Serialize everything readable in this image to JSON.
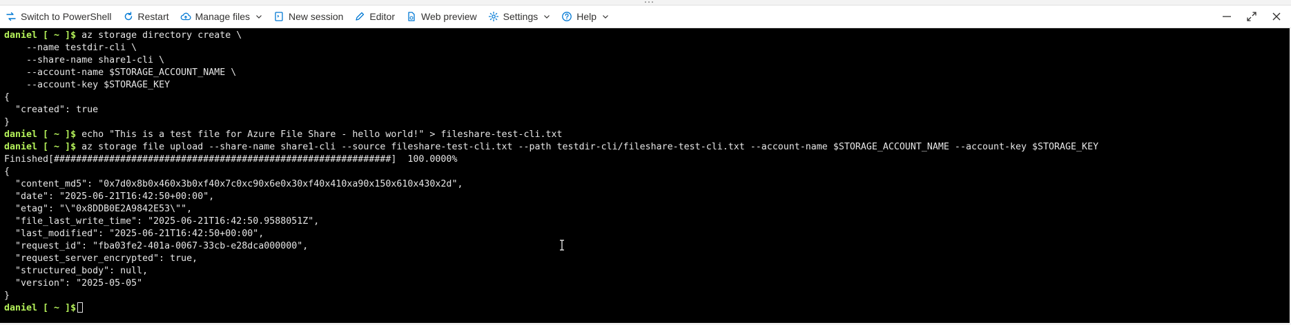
{
  "toolbar": {
    "switch_label": "Switch to PowerShell",
    "restart_label": "Restart",
    "manage_files_label": "Manage files",
    "new_session_label": "New session",
    "editor_label": "Editor",
    "web_preview_label": "Web preview",
    "settings_label": "Settings",
    "help_label": "Help"
  },
  "colors": {
    "terminal_bg": "#000000",
    "prompt_green": "#b5f25a",
    "text": "#e6e6e6",
    "accent_blue": "#0078d4"
  },
  "terminal": {
    "prompt": "daniel [ ~ ]$",
    "lines": [
      {
        "prompt": "daniel [ ~ ]$",
        "text": " az storage directory create \\"
      },
      {
        "prompt": "",
        "text": "    --name testdir-cli \\"
      },
      {
        "prompt": "",
        "text": "    --share-name share1-cli \\"
      },
      {
        "prompt": "",
        "text": "    --account-name $STORAGE_ACCOUNT_NAME \\"
      },
      {
        "prompt": "",
        "text": "    --account-key $STORAGE_KEY"
      },
      {
        "prompt": "",
        "text": "{"
      },
      {
        "prompt": "",
        "text": "  \"created\": true"
      },
      {
        "prompt": "",
        "text": "}"
      },
      {
        "prompt": "daniel [ ~ ]$",
        "text": " echo \"This is a test file for Azure File Share - hello world!\" > fileshare-test-cli.txt"
      },
      {
        "prompt": "daniel [ ~ ]$",
        "text": " az storage file upload --share-name share1-cli --source fileshare-test-cli.txt --path testdir-cli/fileshare-test-cli.txt --account-name $STORAGE_ACCOUNT_NAME --account-key $STORAGE_KEY"
      },
      {
        "prompt": "",
        "text": "Finished[#############################################################]  100.0000%"
      },
      {
        "prompt": "",
        "text": "{"
      },
      {
        "prompt": "",
        "text": "  \"content_md5\": \"0x7d0x8b0x460x3b0xf40x7c0xc90x6e0x30xf40x410xa90x150x610x430x2d\","
      },
      {
        "prompt": "",
        "text": "  \"date\": \"2025-06-21T16:42:50+00:00\","
      },
      {
        "prompt": "",
        "text": "  \"etag\": \"\\\"0x8DDB0E2A9842E53\\\"\","
      },
      {
        "prompt": "",
        "text": "  \"file_last_write_time\": \"2025-06-21T16:42:50.9588051Z\","
      },
      {
        "prompt": "",
        "text": "  \"last_modified\": \"2025-06-21T16:42:50+00:00\","
      },
      {
        "prompt": "",
        "text": "  \"request_id\": \"fba03fe2-401a-0067-33cb-e28dca000000\","
      },
      {
        "prompt": "",
        "text": "  \"request_server_encrypted\": true,"
      },
      {
        "prompt": "",
        "text": "  \"structured_body\": null,"
      },
      {
        "prompt": "",
        "text": "  \"version\": \"2025-05-05\""
      },
      {
        "prompt": "",
        "text": "}"
      }
    ]
  }
}
